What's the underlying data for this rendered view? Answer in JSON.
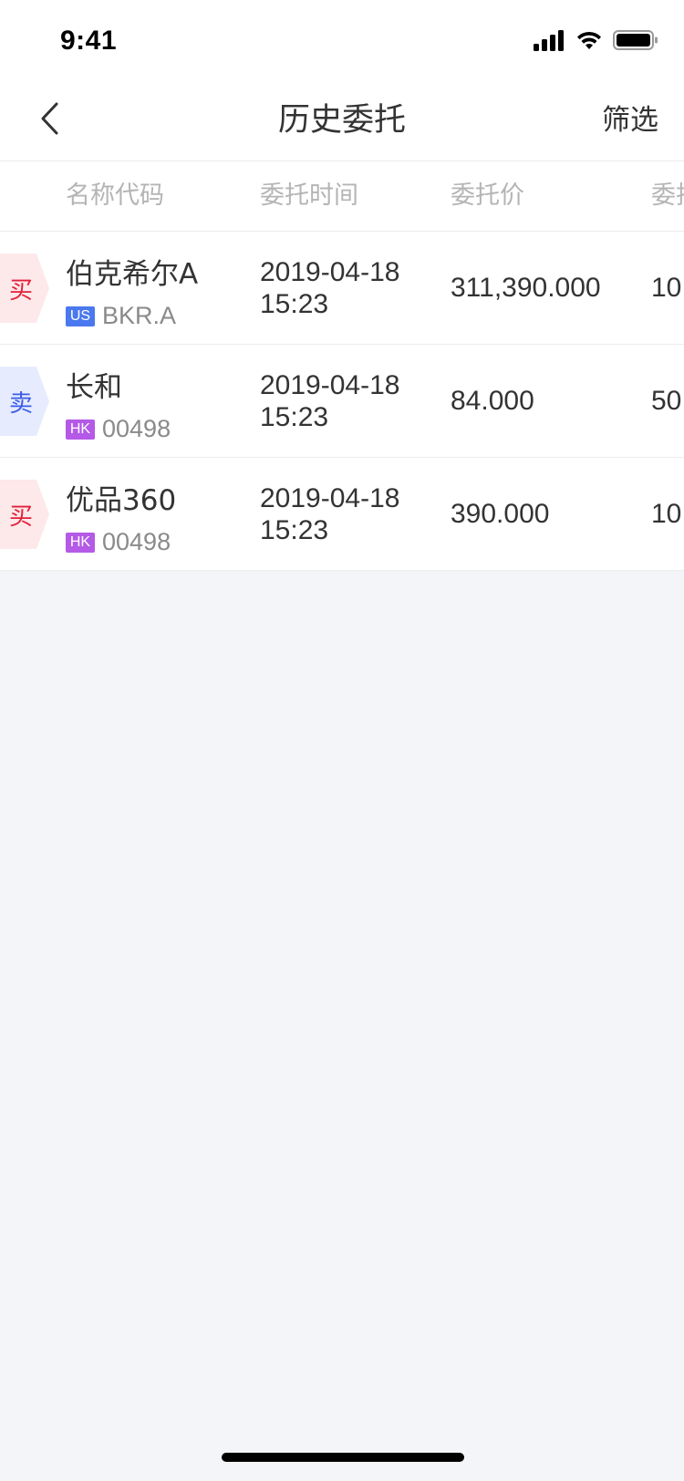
{
  "status_bar": {
    "time": "9:41",
    "icons": [
      "signal-icon",
      "wifi-icon",
      "battery-icon"
    ]
  },
  "nav": {
    "title": "历史委托",
    "filter_label": "筛选",
    "back_icon": "chevron-left-icon"
  },
  "table": {
    "headers": {
      "name": "名称代码",
      "time": "委托时间",
      "price": "委托价",
      "qty": "委托"
    },
    "rows": [
      {
        "side": "买",
        "side_type": "buy",
        "name": "伯克希尔A",
        "market": "US",
        "code": "BKR.A",
        "date": "2019-04-18",
        "time": "15:23",
        "price": "311,390.000",
        "qty": "10"
      },
      {
        "side": "卖",
        "side_type": "sell",
        "name": "长和",
        "market": "HK",
        "code": "00498",
        "date": "2019-04-18",
        "time": "15:23",
        "price": "84.000",
        "qty": "50"
      },
      {
        "side": "买",
        "side_type": "buy",
        "name": "优品360",
        "market": "HK",
        "code": "00498",
        "date": "2019-04-18",
        "time": "15:23",
        "price": "390.000",
        "qty": "10"
      }
    ]
  },
  "colors": {
    "buy_text": "#e2203a",
    "buy_bg": "#fde8ea",
    "sell_text": "#3b5ce8",
    "sell_bg": "#e7ebfe",
    "us_badge": "#4a78ee",
    "hk_badge": "#b45ae6",
    "page_bg": "#f4f5f8"
  }
}
